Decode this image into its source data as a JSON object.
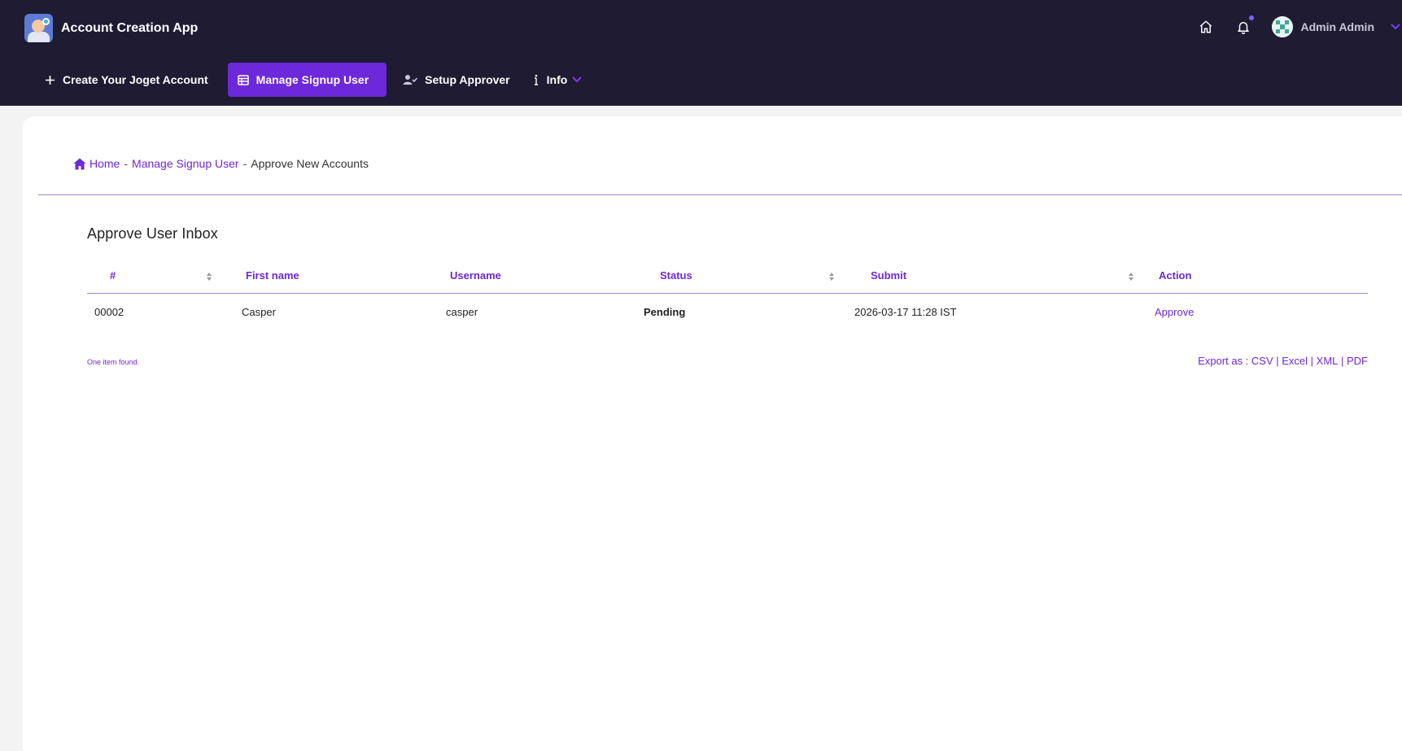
{
  "app": {
    "title": "Account Creation App"
  },
  "user": {
    "name": "Admin Admin"
  },
  "nav": {
    "items": [
      {
        "label": "Create Your Joget Account"
      },
      {
        "label": "Manage Signup User"
      },
      {
        "label": "Setup Approver"
      },
      {
        "label": "Info"
      }
    ]
  },
  "breadcrumb": {
    "home": "Home",
    "sep": "-",
    "parent": "Manage Signup User",
    "current": "Approve New Accounts"
  },
  "inbox": {
    "title": "Approve User Inbox",
    "columns": [
      "#",
      "First name",
      "Username",
      "Status",
      "Submit",
      "Action"
    ],
    "rows": [
      {
        "id": "00002",
        "first_name": "Casper",
        "username": "casper",
        "status": "Pending",
        "submit": "2026-03-17 11:28 IST",
        "action": "Approve"
      }
    ],
    "count_text": "One item found.",
    "export": {
      "prefix": "Export as : ",
      "csv": "CSV",
      "excel": "Excel",
      "xml": "XML",
      "pdf": "PDF",
      "sep": " | "
    }
  },
  "colors": {
    "header_bg": "#1e1b33",
    "accent": "#6d28d9",
    "page_bg": "#f3f3f3"
  }
}
